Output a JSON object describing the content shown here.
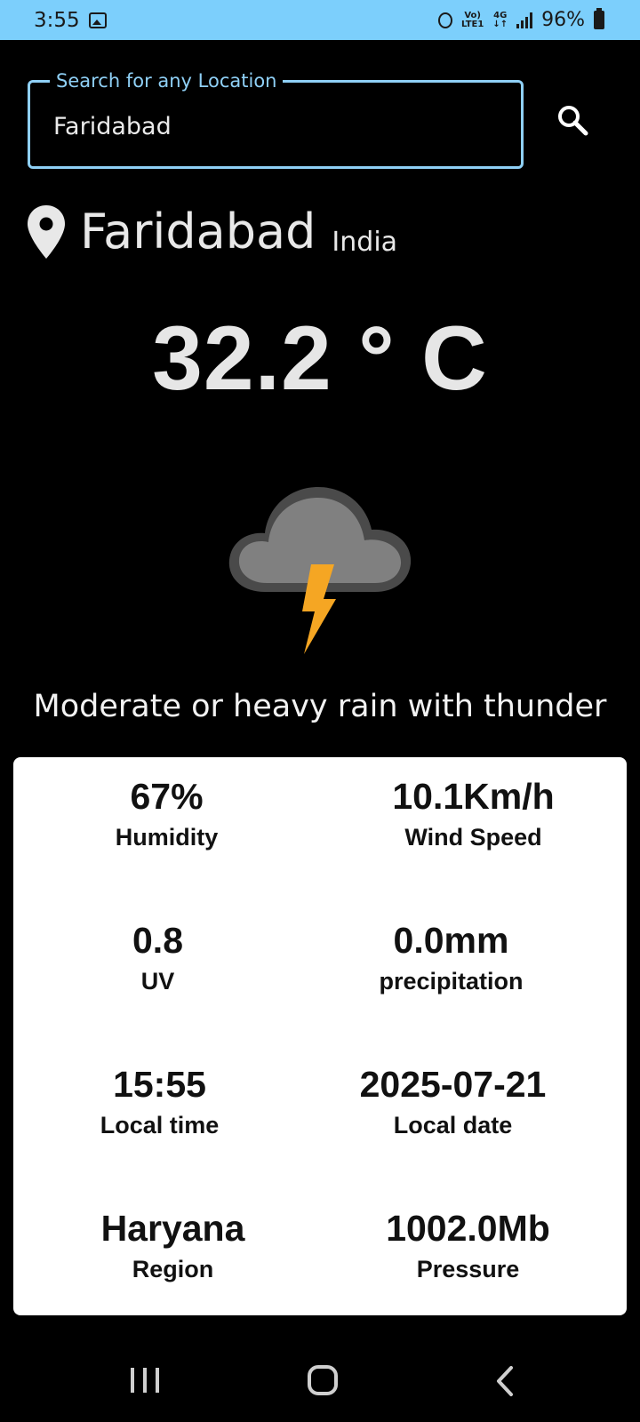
{
  "status_bar": {
    "time": "3:55",
    "network_top": "Vo)",
    "network_bottom": "LTE1",
    "data_top": "4G",
    "data_bottom": "↓↑",
    "battery": "96%"
  },
  "search": {
    "label": "Search for any Location",
    "value": "Faridabad"
  },
  "location": {
    "city": "Faridabad",
    "country": "India"
  },
  "current": {
    "temperature": "32.2 ° C",
    "condition": "Moderate or heavy rain with thunder",
    "icon": "thunder-cloud-icon"
  },
  "details": [
    {
      "value": "67%",
      "label": "Humidity"
    },
    {
      "value": "10.1Km/h",
      "label": "Wind Speed"
    },
    {
      "value": "0.8",
      "label": "UV"
    },
    {
      "value": "0.0mm",
      "label": "precipitation"
    },
    {
      "value": "15:55",
      "label": "Local time"
    },
    {
      "value": "2025-07-21",
      "label": "Local date"
    },
    {
      "value": "Haryana",
      "label": "Region"
    },
    {
      "value": "1002.0Mb",
      "label": "Pressure"
    }
  ],
  "colors": {
    "status_bar": "#7ccffc",
    "accent": "#8fd0f6",
    "background": "#000000",
    "card": "#ffffff"
  }
}
